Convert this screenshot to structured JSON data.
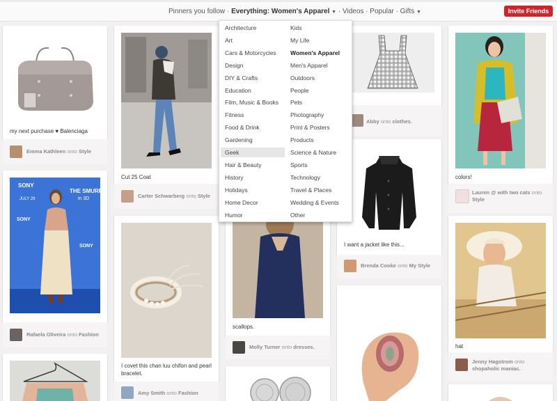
{
  "header": {
    "nav": {
      "pinners": "Pinners you follow",
      "sep1": "·",
      "everything": "Everything: Women's Apparel",
      "sep2": "·",
      "videos": "Videos",
      "sep3": "·",
      "popular": "Popular",
      "sep4": "·",
      "gifts": "Gifts"
    },
    "invite_label": "Invite Friends"
  },
  "dropdown": {
    "left": [
      "Architecture",
      "Art",
      "Cars & Motorcycles",
      "Design",
      "DIY & Crafts",
      "Education",
      "Film, Music & Books",
      "Fitness",
      "Food & Drink",
      "Gardening",
      "Geek",
      "Hair & Beauty",
      "History",
      "Holidays",
      "Home Decor",
      "Humor"
    ],
    "right": [
      "Kids",
      "My Life",
      "Women's Apparel",
      "Men's Apparel",
      "Outdoors",
      "People",
      "Pets",
      "Photography",
      "Print & Posters",
      "Products",
      "Science & Nature",
      "Sports",
      "Technology",
      "Travel & Places",
      "Wedding & Events",
      "Other"
    ],
    "highlighted": "Geek",
    "current": "Women's Apparel"
  },
  "pins": {
    "p1": {
      "caption": "my next purchase ♥ Balenciaga",
      "user": "Emma Kathleen",
      "onto": "onto",
      "board": "Style"
    },
    "p2": {
      "caption": "",
      "user": "Rafaela Oliveira",
      "onto": "onto",
      "board": "Fashion"
    },
    "p4": {
      "caption": "Cut 25 Coat",
      "user": "Carter Schwarberg",
      "onto": "onto",
      "board": "Style"
    },
    "p5": {
      "caption1": "I covet this chan luu chifon and pearl",
      "caption2": "bracelet.",
      "user": "Amy Smith",
      "onto": "onto",
      "board": "Fashion"
    },
    "p6": {
      "caption": "scallops.",
      "user": "Molly Turner",
      "onto": "onto",
      "board": "dresses."
    },
    "p8": {
      "user": "Abby",
      "onto": "onto",
      "board": "clothes."
    },
    "p9": {
      "caption": "I want a jacket like this...",
      "user": "Brenda Cooke",
      "onto": "onto",
      "board": "My Style"
    },
    "p11": {
      "caption": "colors!",
      "user": "Lauren @ with two cats",
      "onto": "onto",
      "board": "Style"
    },
    "p12": {
      "caption": "hat",
      "user": "Jenny Hagstrom",
      "onto": "onto",
      "board": "shopaholic maniac."
    }
  },
  "smurfs_backdrop": {
    "brand": "SONY",
    "title": "THE SMURFS",
    "subtitle": "in 3D",
    "date": "JULY 29"
  },
  "colors": {
    "accent": "#c9262e",
    "page_bg": "#f2f0f0"
  }
}
